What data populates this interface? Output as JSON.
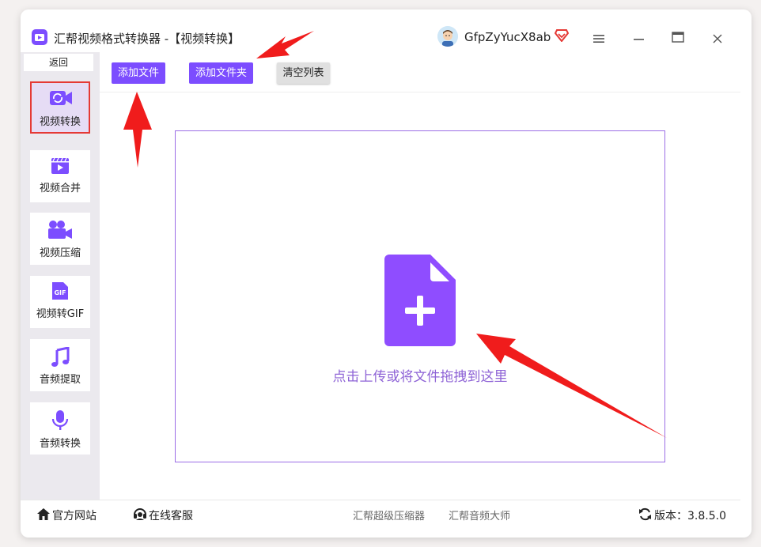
{
  "window": {
    "title": "汇帮视频格式转换器  -【视频转换】",
    "username": "GfpZyYucX8ab"
  },
  "sidebar": {
    "back": "返回",
    "items": [
      {
        "label": "视频转换",
        "icon": "video-convert-icon",
        "active": true
      },
      {
        "label": "视频合并",
        "icon": "video-merge-icon"
      },
      {
        "label": "视频压缩",
        "icon": "video-compress-icon"
      },
      {
        "label": "视频转GIF",
        "icon": "gif-icon"
      },
      {
        "label": "音频提取",
        "icon": "music-note-icon"
      },
      {
        "label": "音频转换",
        "icon": "microphone-icon"
      }
    ]
  },
  "toolbar": {
    "add_file": "添加文件",
    "add_folder": "添加文件夹",
    "clear_list": "清空列表"
  },
  "dropzone": {
    "text": "点击上传或将文件拖拽到这里",
    "icon": "file-add-icon"
  },
  "footer": {
    "website": "官方网站",
    "support": "在线客服",
    "link1": "汇帮超级压缩器",
    "link2": "汇帮音频大师",
    "version": "版本：3.8.5.0"
  },
  "colors": {
    "accent": "#7c4dff",
    "annotation": "#f01c1c",
    "active_border": "#e53935"
  }
}
